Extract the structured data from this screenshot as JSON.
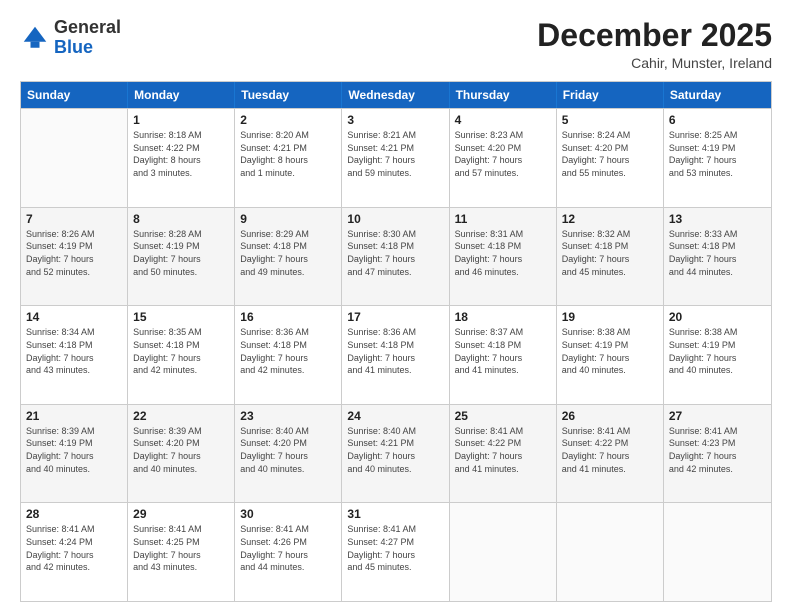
{
  "logo": {
    "general": "General",
    "blue": "Blue"
  },
  "header": {
    "month": "December 2025",
    "location": "Cahir, Munster, Ireland"
  },
  "days_of_week": [
    "Sunday",
    "Monday",
    "Tuesday",
    "Wednesday",
    "Thursday",
    "Friday",
    "Saturday"
  ],
  "weeks": [
    [
      {
        "day": "",
        "details": []
      },
      {
        "day": "1",
        "details": [
          "Sunrise: 8:18 AM",
          "Sunset: 4:22 PM",
          "Daylight: 8 hours",
          "and 3 minutes."
        ]
      },
      {
        "day": "2",
        "details": [
          "Sunrise: 8:20 AM",
          "Sunset: 4:21 PM",
          "Daylight: 8 hours",
          "and 1 minute."
        ]
      },
      {
        "day": "3",
        "details": [
          "Sunrise: 8:21 AM",
          "Sunset: 4:21 PM",
          "Daylight: 7 hours",
          "and 59 minutes."
        ]
      },
      {
        "day": "4",
        "details": [
          "Sunrise: 8:23 AM",
          "Sunset: 4:20 PM",
          "Daylight: 7 hours",
          "and 57 minutes."
        ]
      },
      {
        "day": "5",
        "details": [
          "Sunrise: 8:24 AM",
          "Sunset: 4:20 PM",
          "Daylight: 7 hours",
          "and 55 minutes."
        ]
      },
      {
        "day": "6",
        "details": [
          "Sunrise: 8:25 AM",
          "Sunset: 4:19 PM",
          "Daylight: 7 hours",
          "and 53 minutes."
        ]
      }
    ],
    [
      {
        "day": "7",
        "details": [
          "Sunrise: 8:26 AM",
          "Sunset: 4:19 PM",
          "Daylight: 7 hours",
          "and 52 minutes."
        ]
      },
      {
        "day": "8",
        "details": [
          "Sunrise: 8:28 AM",
          "Sunset: 4:19 PM",
          "Daylight: 7 hours",
          "and 50 minutes."
        ]
      },
      {
        "day": "9",
        "details": [
          "Sunrise: 8:29 AM",
          "Sunset: 4:18 PM",
          "Daylight: 7 hours",
          "and 49 minutes."
        ]
      },
      {
        "day": "10",
        "details": [
          "Sunrise: 8:30 AM",
          "Sunset: 4:18 PM",
          "Daylight: 7 hours",
          "and 47 minutes."
        ]
      },
      {
        "day": "11",
        "details": [
          "Sunrise: 8:31 AM",
          "Sunset: 4:18 PM",
          "Daylight: 7 hours",
          "and 46 minutes."
        ]
      },
      {
        "day": "12",
        "details": [
          "Sunrise: 8:32 AM",
          "Sunset: 4:18 PM",
          "Daylight: 7 hours",
          "and 45 minutes."
        ]
      },
      {
        "day": "13",
        "details": [
          "Sunrise: 8:33 AM",
          "Sunset: 4:18 PM",
          "Daylight: 7 hours",
          "and 44 minutes."
        ]
      }
    ],
    [
      {
        "day": "14",
        "details": [
          "Sunrise: 8:34 AM",
          "Sunset: 4:18 PM",
          "Daylight: 7 hours",
          "and 43 minutes."
        ]
      },
      {
        "day": "15",
        "details": [
          "Sunrise: 8:35 AM",
          "Sunset: 4:18 PM",
          "Daylight: 7 hours",
          "and 42 minutes."
        ]
      },
      {
        "day": "16",
        "details": [
          "Sunrise: 8:36 AM",
          "Sunset: 4:18 PM",
          "Daylight: 7 hours",
          "and 42 minutes."
        ]
      },
      {
        "day": "17",
        "details": [
          "Sunrise: 8:36 AM",
          "Sunset: 4:18 PM",
          "Daylight: 7 hours",
          "and 41 minutes."
        ]
      },
      {
        "day": "18",
        "details": [
          "Sunrise: 8:37 AM",
          "Sunset: 4:18 PM",
          "Daylight: 7 hours",
          "and 41 minutes."
        ]
      },
      {
        "day": "19",
        "details": [
          "Sunrise: 8:38 AM",
          "Sunset: 4:19 PM",
          "Daylight: 7 hours",
          "and 40 minutes."
        ]
      },
      {
        "day": "20",
        "details": [
          "Sunrise: 8:38 AM",
          "Sunset: 4:19 PM",
          "Daylight: 7 hours",
          "and 40 minutes."
        ]
      }
    ],
    [
      {
        "day": "21",
        "details": [
          "Sunrise: 8:39 AM",
          "Sunset: 4:19 PM",
          "Daylight: 7 hours",
          "and 40 minutes."
        ]
      },
      {
        "day": "22",
        "details": [
          "Sunrise: 8:39 AM",
          "Sunset: 4:20 PM",
          "Daylight: 7 hours",
          "and 40 minutes."
        ]
      },
      {
        "day": "23",
        "details": [
          "Sunrise: 8:40 AM",
          "Sunset: 4:20 PM",
          "Daylight: 7 hours",
          "and 40 minutes."
        ]
      },
      {
        "day": "24",
        "details": [
          "Sunrise: 8:40 AM",
          "Sunset: 4:21 PM",
          "Daylight: 7 hours",
          "and 40 minutes."
        ]
      },
      {
        "day": "25",
        "details": [
          "Sunrise: 8:41 AM",
          "Sunset: 4:22 PM",
          "Daylight: 7 hours",
          "and 41 minutes."
        ]
      },
      {
        "day": "26",
        "details": [
          "Sunrise: 8:41 AM",
          "Sunset: 4:22 PM",
          "Daylight: 7 hours",
          "and 41 minutes."
        ]
      },
      {
        "day": "27",
        "details": [
          "Sunrise: 8:41 AM",
          "Sunset: 4:23 PM",
          "Daylight: 7 hours",
          "and 42 minutes."
        ]
      }
    ],
    [
      {
        "day": "28",
        "details": [
          "Sunrise: 8:41 AM",
          "Sunset: 4:24 PM",
          "Daylight: 7 hours",
          "and 42 minutes."
        ]
      },
      {
        "day": "29",
        "details": [
          "Sunrise: 8:41 AM",
          "Sunset: 4:25 PM",
          "Daylight: 7 hours",
          "and 43 minutes."
        ]
      },
      {
        "day": "30",
        "details": [
          "Sunrise: 8:41 AM",
          "Sunset: 4:26 PM",
          "Daylight: 7 hours",
          "and 44 minutes."
        ]
      },
      {
        "day": "31",
        "details": [
          "Sunrise: 8:41 AM",
          "Sunset: 4:27 PM",
          "Daylight: 7 hours",
          "and 45 minutes."
        ]
      },
      {
        "day": "",
        "details": []
      },
      {
        "day": "",
        "details": []
      },
      {
        "day": "",
        "details": []
      }
    ]
  ]
}
